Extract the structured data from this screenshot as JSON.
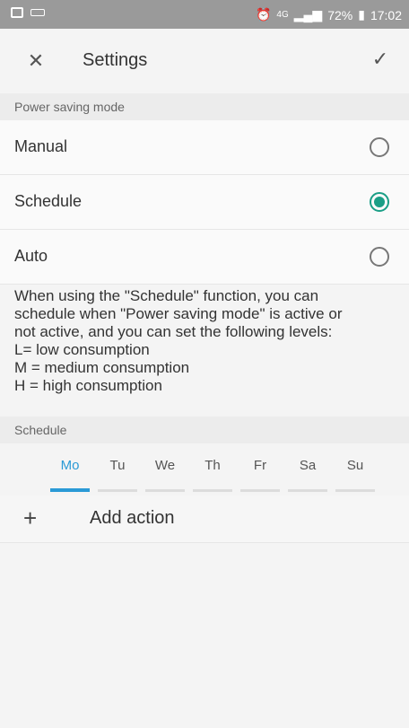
{
  "status_bar": {
    "battery": "72%",
    "time": "17:02",
    "network": "4G"
  },
  "header": {
    "title": "Settings"
  },
  "power_saving": {
    "section_title": "Power saving mode",
    "options": [
      {
        "label": "Manual",
        "selected": false
      },
      {
        "label": "Schedule",
        "selected": true
      },
      {
        "label": "Auto",
        "selected": false
      }
    ]
  },
  "description": {
    "lines": [
      "When using the \"Schedule\" function, you can",
      "schedule when \"Power saving mode\" is active or",
      "not active, and you can set the following levels:",
      "L= low consumption",
      "M = medium consumption",
      "H = high consumption"
    ]
  },
  "schedule": {
    "section_title": "Schedule",
    "days": [
      "Mo",
      "Tu",
      "We",
      "Th",
      "Fr",
      "Sa",
      "Su"
    ],
    "active_day": "Mo",
    "add_action_label": "Add action",
    "add_icon": "+"
  },
  "colors": {
    "accent_radio": "#1a9e86",
    "accent_tab": "#2a9ad6"
  }
}
